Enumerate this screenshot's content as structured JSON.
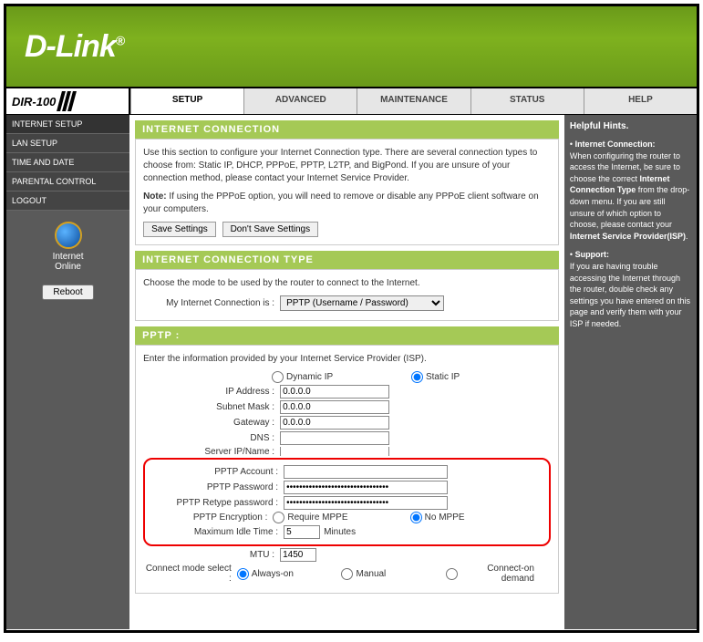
{
  "brand": "D-Link",
  "model": "DIR-100",
  "tabs": [
    "SETUP",
    "ADVANCED",
    "MAINTENANCE",
    "STATUS",
    "HELP"
  ],
  "activeTab": 0,
  "sidebar": [
    "INTERNET SETUP",
    "LAN SETUP",
    "TIME AND DATE",
    "PARENTAL CONTROL",
    "LOGOUT"
  ],
  "status": {
    "label1": "Internet",
    "label2": "Online"
  },
  "rebootBtn": "Reboot",
  "sec1": {
    "title": "INTERNET CONNECTION",
    "text": "Use this section to configure your Internet Connection type. There are several connection types to choose from: Static IP, DHCP, PPPoE, PPTP, L2TP, and BigPond. If you are unsure of your connection method, please contact your Internet Service Provider.",
    "noteLabel": "Note:",
    "noteText": " If using the PPPoE option, you will need to remove or disable any PPPoE client software on your computers.",
    "save": "Save Settings",
    "dontSave": "Don't Save Settings"
  },
  "sec2": {
    "title": "INTERNET CONNECTION TYPE",
    "text": "Choose the mode to be used by the router to connect to the Internet.",
    "label": "My Internet Connection is :",
    "value": "PPTP (Username / Password)"
  },
  "sec3": {
    "title": "PPTP :",
    "intro": "Enter the information provided by your Internet Service Provider (ISP).",
    "dynIP": "Dynamic IP",
    "statIP": "Static IP",
    "ipLabel": "IP Address :",
    "ipVal": "0.0.0.0",
    "maskLabel": "Subnet Mask :",
    "maskVal": "0.0.0.0",
    "gwLabel": "Gateway :",
    "gwVal": "0.0.0.0",
    "dnsLabel": "DNS :",
    "dnsVal": "",
    "srvLabel": "Server IP/Name :",
    "srvVal": "",
    "acctLabel": "PPTP Account :",
    "acctVal": "",
    "pwdLabel": "PPTP Password :",
    "pwdVal": "••••••••••••••••••••••••••••••••",
    "rpwdLabel": "PPTP Retype password :",
    "rpwdVal": "••••••••••••••••••••••••••••••••",
    "encLabel": "PPTP Encryption :",
    "enc1": "Require MPPE",
    "enc2": "No MPPE",
    "idleLabel": "Maximum Idle Time :",
    "idleVal": "5",
    "idleUnit": "Minutes",
    "mtuLabel": "MTU :",
    "mtuVal": "1450",
    "modeLabel": "Connect mode select :",
    "mode1": "Always-on",
    "mode2": "Manual",
    "mode3": "Connect-on demand"
  },
  "hints": {
    "title": "Helpful Hints.",
    "b1": "Internet Connection:",
    "t1": "When configuring the router to access the Internet, be sure to choose the correct ",
    "b2": "Internet Connection Type",
    "t2": " from the drop-down menu. If you are still unsure of which option to choose, please contact your ",
    "b3": "Internet Service Provider(ISP)",
    "t3": ".",
    "b4": "Support:",
    "t4": "If you are having trouble accessing the Internet through the router, double check any settings you have entered on this page and verify them with your ISP if needed."
  }
}
